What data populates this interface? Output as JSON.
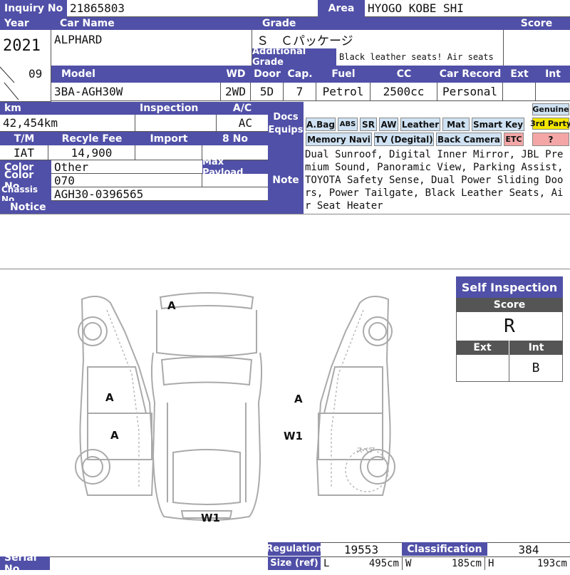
{
  "inquiry": {
    "label": "Inquiry No",
    "value": "21865803"
  },
  "area": {
    "label": "Area",
    "value": "HYOGO KOBE SHI"
  },
  "year": {
    "label": "Year",
    "value": "2021",
    "month": "09"
  },
  "car_name": {
    "label": "Car Name",
    "value": "ALPHARD"
  },
  "grade": {
    "label": "Grade",
    "value": "Ｓ　Ｃパッケージ"
  },
  "additional_grade": {
    "label": "Additional Grade",
    "value": "Black leather seats! Air seats"
  },
  "score": {
    "label": "Score",
    "value": ""
  },
  "model": {
    "label": "Model",
    "value": "3BA-AGH30W"
  },
  "wd": {
    "label": "WD",
    "value": "2WD"
  },
  "door": {
    "label": "Door",
    "value": "5D"
  },
  "cap": {
    "label": "Cap.",
    "value": "7"
  },
  "fuel": {
    "label": "Fuel",
    "value": "Petrol"
  },
  "cc": {
    "label": "CC",
    "value": "2500cc"
  },
  "car_record": {
    "label": "Car Record",
    "value": "Personal"
  },
  "ext": {
    "label": "Ext",
    "value": ""
  },
  "int": {
    "label": "Int",
    "value": ""
  },
  "km": {
    "label": "km",
    "value": "42,454km"
  },
  "inspection": {
    "label": "Inspection",
    "value": ""
  },
  "ac": {
    "label": "A/C",
    "value": "AC"
  },
  "docs_equips": {
    "label_line1": "Docs",
    "label_line2": "Equips"
  },
  "equips": {
    "abag": "A.Bag",
    "abs": "ABS",
    "sr": "SR",
    "aw": "AW",
    "leather": "Leather",
    "mat": "Mat",
    "smart_key": "Smart Key",
    "memory_navi": "Memory Navi",
    "tv": "TV (Degital)",
    "back_camera": "Back Camera",
    "etc": "ETC"
  },
  "docs": {
    "genuine": "Genuine",
    "third_party": "3rd Party",
    "unknown": "?"
  },
  "tm": {
    "label": "T/M",
    "value": "IAT"
  },
  "recycle_fee": {
    "label": "Recyle Fee",
    "value": "14,900"
  },
  "import": {
    "label": "Import",
    "value": ""
  },
  "eight_no": {
    "label": "8 No",
    "value": ""
  },
  "color": {
    "label": "Color",
    "value": "Other"
  },
  "max_payload": {
    "label": "Max Payload",
    "value": ""
  },
  "color_no": {
    "label": "Color No",
    "value": "070"
  },
  "chassis_no": {
    "label": "Chassis No",
    "value": "AGH30-0396565"
  },
  "notice": {
    "label": "Notice",
    "value": ""
  },
  "note": {
    "label": "Note",
    "value": "Dual Sunroof, Digital Inner Mirror, JBL Premium Sound, Panoramic View, Parking Assist, TOYOTA Safety Sense, Dual Power Sliding Doors, Power Tailgate, Black Leather Seats, Air Seat Heater"
  },
  "damage_marks": {
    "front": "A",
    "left_front_door": "A",
    "left_rear_door": "A",
    "right_front_door": "A",
    "right_rear_door": "W1",
    "rear": "W1",
    "spare": "スペア"
  },
  "self_inspection": {
    "title": "Self Inspection",
    "score_label": "Score",
    "score_value": "R",
    "ext_label": "Ext",
    "int_label": "Int",
    "ext_value": "",
    "int_value": "B"
  },
  "regulation": {
    "label": "Regulation",
    "value": "19553"
  },
  "classification": {
    "label": "Classification",
    "value": "384"
  },
  "size": {
    "label": "Size (ref)",
    "l_label": "L",
    "l_value": "495cm",
    "w_label": "W",
    "w_value": "185cm",
    "h_label": "H",
    "h_value": "193cm"
  },
  "serial_no": {
    "label": "Serial No",
    "value": ""
  },
  "colors": {
    "header": "#5050a8",
    "chip": "#cfe2f3",
    "etc": "#f4a6a6",
    "third_party": "#f2e600",
    "unknown": "#f4a6a6"
  }
}
